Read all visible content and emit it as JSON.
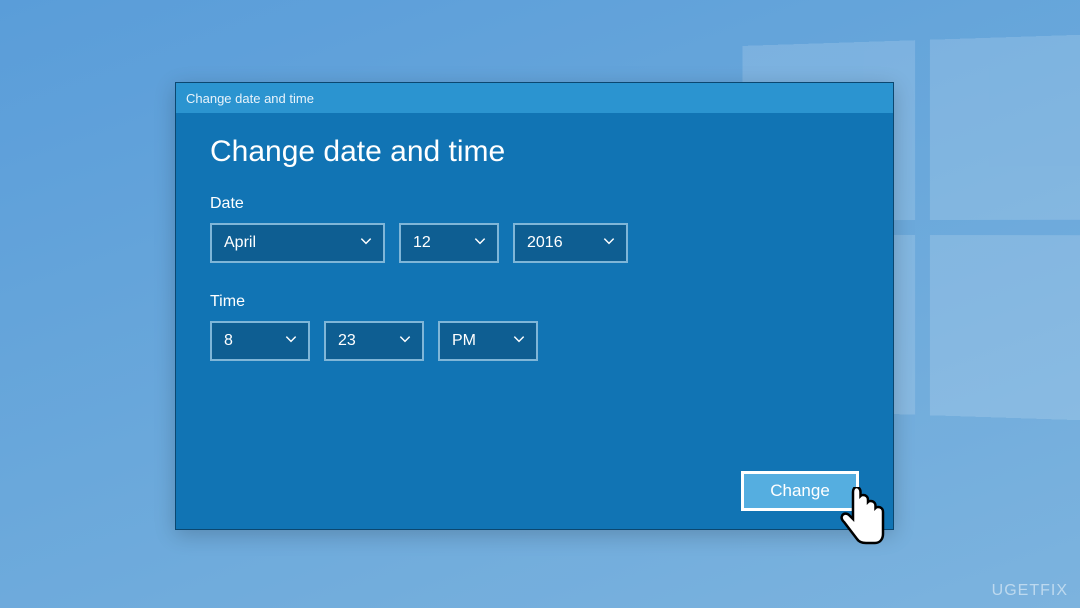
{
  "titlebar": "Change date and time",
  "heading": "Change date and time",
  "date_section": {
    "label": "Date",
    "month": "April",
    "day": "12",
    "year": "2016"
  },
  "time_section": {
    "label": "Time",
    "hour": "8",
    "minute": "23",
    "ampm": "PM"
  },
  "buttons": {
    "change": "Change"
  },
  "watermark": "UGETFIX"
}
